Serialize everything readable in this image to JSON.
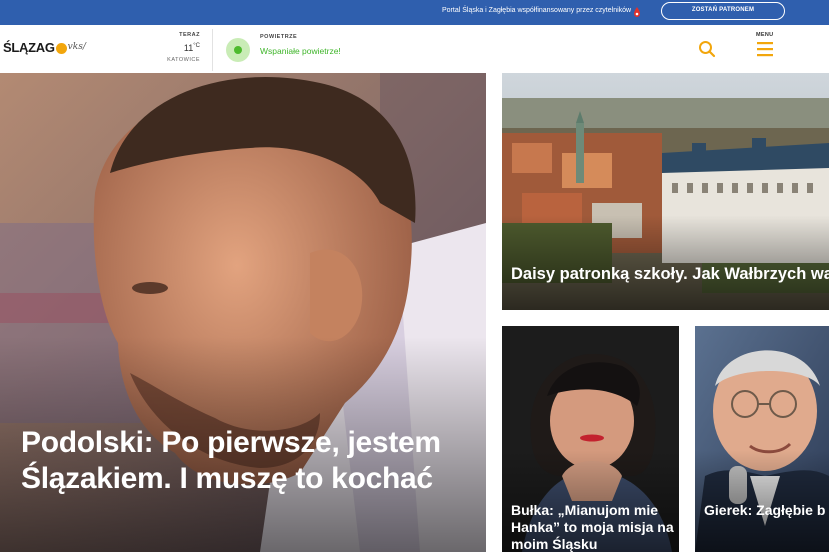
{
  "topbar": {
    "text": "Portal Śląska i Zagłębia współfinansowany przez czytelników",
    "patron_button": "ZOSTAŃ PATRONEM"
  },
  "header": {
    "logo_main": "ŚLĄZAG",
    "logo_script": "vks/",
    "weather": {
      "label": "TERAZ",
      "temp": "11",
      "unit": "°C",
      "city": "KATOWICE"
    },
    "air": {
      "label": "POWIETRZE",
      "status": "Wspaniałe powietrze!"
    },
    "menu_label": "MENU"
  },
  "stories": {
    "hero": {
      "title": "Podolski: Po pierwsze, jestem Ślązakiem. I muszę to kochać"
    },
    "top_right": {
      "title": "Daisy patronką szkoły. Jak Wałbrzych walc Pszczynę"
    },
    "bottom_left": {
      "title": "Bułka: „Mianujom mie Hanka” to moja misja na moim Śląsku"
    },
    "bottom_right": {
      "title": "Gierek: Zagłębie b kompleksu Śląska Jesteśmy krojcuni"
    }
  },
  "colors": {
    "brand_blue": "#2f5fae",
    "accent_orange": "#f2a60c",
    "air_green": "#3fb52a"
  },
  "icons": [
    "heart-icon",
    "search-icon",
    "hamburger-menu-icon",
    "air-quality-dot-icon"
  ]
}
